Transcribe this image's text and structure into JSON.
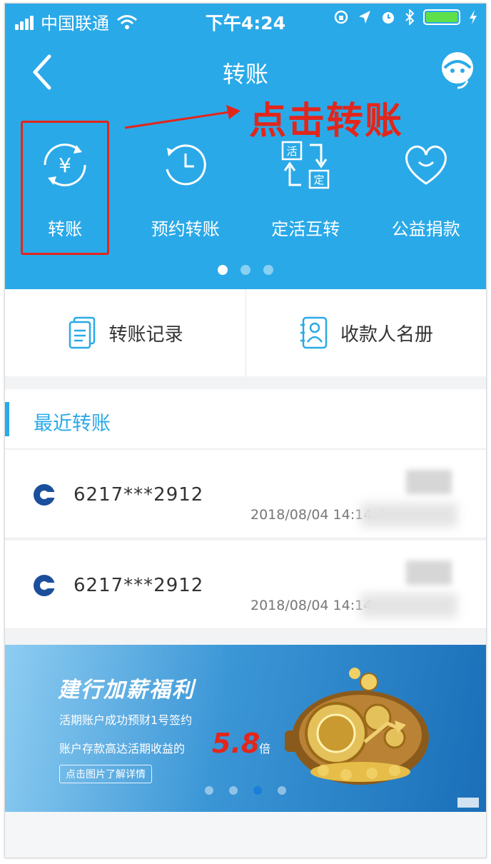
{
  "status_bar": {
    "carrier": "中国联通",
    "time": "下午4:24"
  },
  "nav": {
    "title": "转账"
  },
  "annotation": {
    "text": "点击转账",
    "color": "#e2261b"
  },
  "quick_actions": [
    {
      "label": "转账",
      "icon": "yuan-transfer-icon"
    },
    {
      "label": "预约转账",
      "icon": "clock-icon"
    },
    {
      "label": "定活互转",
      "icon": "exchange-icon"
    },
    {
      "label": "公益捐款",
      "icon": "heart-icon"
    }
  ],
  "pager": {
    "count": 3,
    "active": 1
  },
  "shortcuts": [
    {
      "label": "转账记录",
      "icon": "document-icon"
    },
    {
      "label": "收款人名册",
      "icon": "contact-book-icon"
    }
  ],
  "recent": {
    "title": "最近转账",
    "items": [
      {
        "account": "6217***2912",
        "time": "2018/08/04 14:14:4"
      },
      {
        "account": "6217***2912",
        "time": "2018/08/04 14:14."
      }
    ]
  },
  "banner": {
    "title": "建行加薪福利",
    "line1": "活期账户成功预财1号签约",
    "line2": "账户存款高达活期收益的",
    "multiplier": "5.8",
    "suffix": "倍",
    "button": "点击图片了解详情"
  },
  "colors": {
    "header_blue": "#2aa9e8",
    "accent_red": "#e2261b"
  }
}
